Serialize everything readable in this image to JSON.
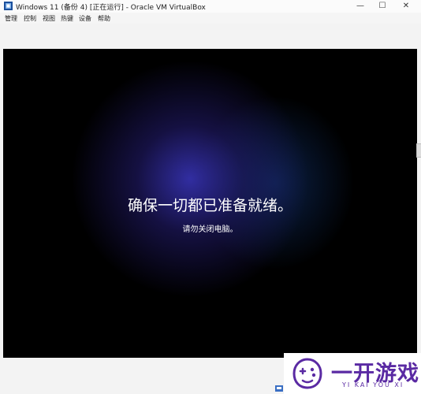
{
  "window": {
    "title": "Windows 11 (备份 4) [正在运行] - Oracle VM VirtualBox",
    "controls": {
      "minimize": "—",
      "maximize": "☐",
      "close": "✕"
    }
  },
  "menu": [
    "管理",
    "控制",
    "视图",
    "热键",
    "设备",
    "帮助"
  ],
  "vm_screen": {
    "main_text": "确保一切都已准备就绪。",
    "sub_text": "请勿关闭电脑。"
  },
  "watermark": {
    "text": "一开游戏",
    "pinyin": "YI KAI YOU XI"
  },
  "colors": {
    "accent": "#5a2aa3",
    "vm_glow": "#3430aa"
  }
}
